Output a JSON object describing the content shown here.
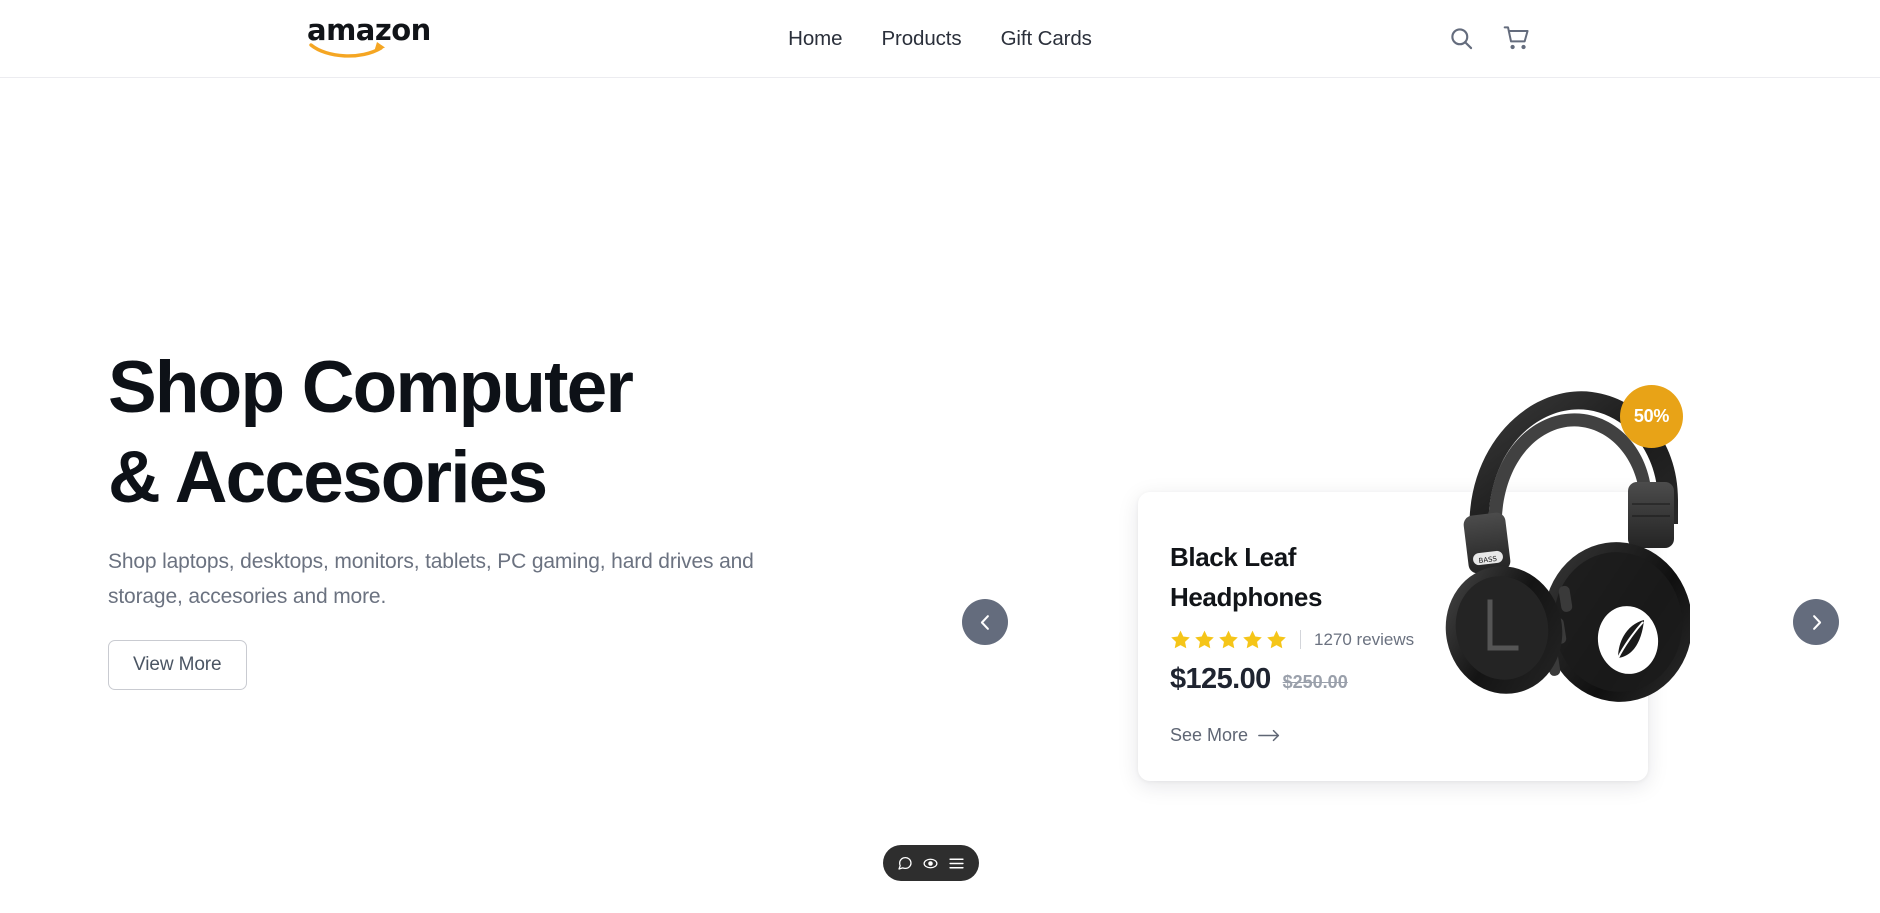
{
  "header": {
    "logo": {
      "text": "amazon",
      "name": "amazon-logo",
      "smile_color": "#f5a623"
    },
    "nav": [
      {
        "label": "Home"
      },
      {
        "label": "Products"
      },
      {
        "label": "Gift Cards"
      }
    ],
    "icons": [
      {
        "name": "search-icon"
      },
      {
        "name": "cart-icon"
      }
    ],
    "icon_color": "#646c7d"
  },
  "hero": {
    "title_line1": "Shop Computer",
    "title_line2": "& Accesories",
    "subtitle": "Shop laptops, desktops, monitors, tablets, PC gaming, hard drives and storage, accesories and more.",
    "cta_label": "View More",
    "title_color": "#0d1117",
    "subtitle_color": "#6b7280"
  },
  "carousel": {
    "prev_label": "‹",
    "next_label": "›",
    "button_color": "#646c7d"
  },
  "product": {
    "title_line1": "Black Leaf",
    "title_line2": "Headphones",
    "stars_filled": 5,
    "stars_total": 5,
    "star_color": "#f5c518",
    "reviews": "1270 reviews",
    "price_current": "$125.00",
    "price_original": "$250.00",
    "see_more_label": "See More",
    "discount_badge": "50%",
    "badge_color": "#e8a317",
    "image_alt": "black-over-ear-headphones"
  },
  "floating_widget": {
    "background": "#2e2e2e",
    "icons": [
      {
        "name": "chat-icon"
      },
      {
        "name": "accessibility-eye-icon"
      },
      {
        "name": "menu-icon"
      }
    ]
  }
}
